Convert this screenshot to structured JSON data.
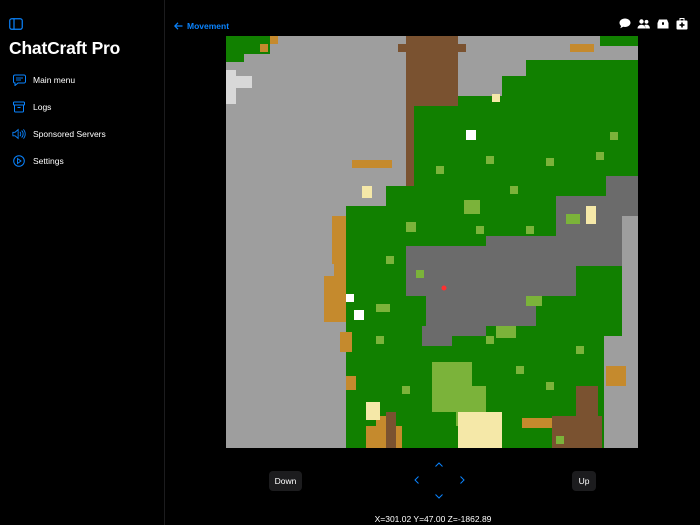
{
  "app": {
    "title": "ChatCraft Pro",
    "accent_color": "#0a84ff"
  },
  "sidebar": {
    "toggle_icon": "sidebar-icon",
    "items": [
      {
        "label": "Main menu",
        "icon": "chat-bubble-icon"
      },
      {
        "label": "Logs",
        "icon": "archive-box-icon"
      },
      {
        "label": "Sponsored Servers",
        "icon": "speaker-wave-icon"
      },
      {
        "label": "Settings",
        "icon": "gear-circle-icon"
      }
    ]
  },
  "header": {
    "back_label": "Movement",
    "icons": [
      "chat-bubble-icon",
      "people-icon",
      "inventory-icon",
      "medkit-icon"
    ]
  },
  "controls": {
    "down_label": "Down",
    "up_label": "Up"
  },
  "status": {
    "coordinates": "X=301.02 Y=47.00 Z=-1862.89"
  },
  "map": {
    "palette": {
      "stone": "#9e9e9e",
      "dark_stone": "#6b6b6b",
      "grass": "#118000",
      "light_grass": "#7bb33a",
      "dirt": "#7a5230",
      "sand": "#c58a2d",
      "pale": "#f5e8a8",
      "white": "#ffffff",
      "snow": "#d8d8d8",
      "player": "#ff3030"
    }
  }
}
